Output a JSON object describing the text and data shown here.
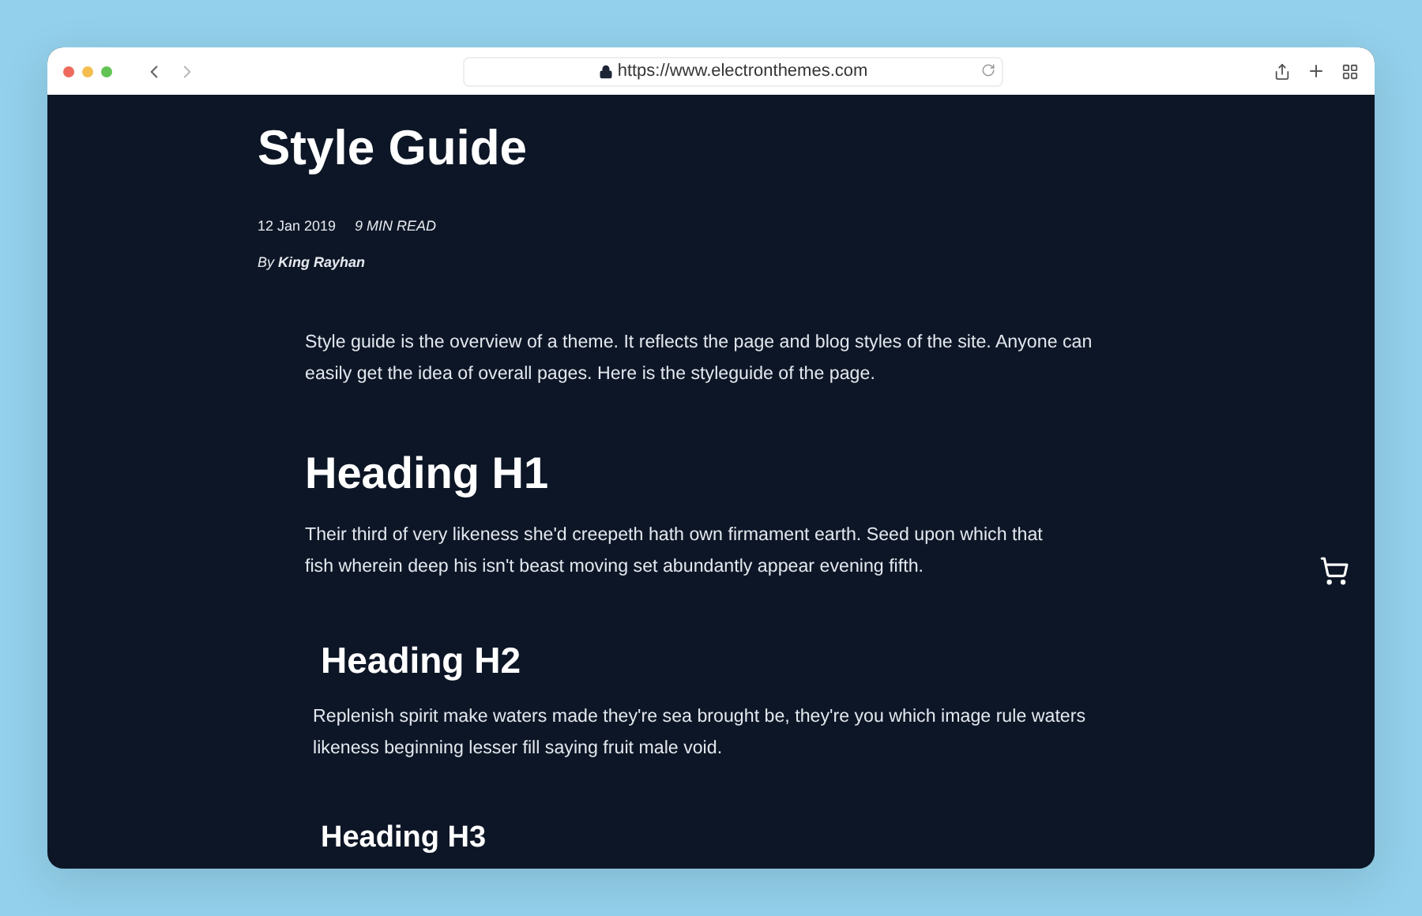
{
  "browser": {
    "url": "https://www.electronthemes.com"
  },
  "post": {
    "title": "Style Guide",
    "date": "12 Jan 2019",
    "read_time": "9 MIN READ",
    "byline_prefix": "By",
    "author": "King Rayhan"
  },
  "intro": "Style guide is the overview of a theme. It reflects the page and blog styles of the site. Anyone can easily get the idea of overall pages. Here is the styleguide of the page.",
  "sections": [
    {
      "kind": "h1",
      "heading": "Heading H1",
      "text": "Their third of very likeness she'd creepeth hath own firmament  earth. Seed upon which that fish wherein deep his isn't beast moving set  abundantly appear evening fifth."
    },
    {
      "kind": "h2",
      "heading": "Heading H2",
      "text": "Replenish spirit make waters made  they're sea brought be, they're you which image rule waters likeness  beginning lesser fill saying fruit male void."
    },
    {
      "kind": "h3",
      "heading": "Heading H3"
    }
  ]
}
